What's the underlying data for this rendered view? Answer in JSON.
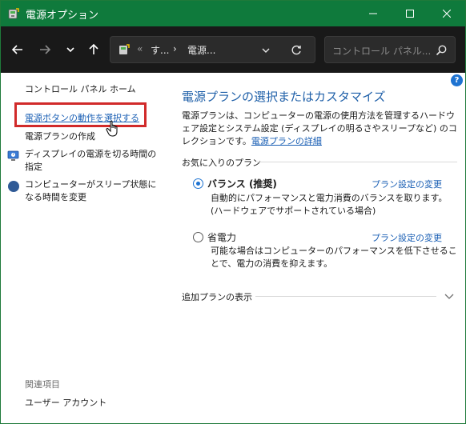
{
  "window": {
    "title": "電源オプション",
    "accent_color": "#0f7a3c"
  },
  "navbar": {
    "breadcrumb": {
      "overflow": "«",
      "item1": "す...",
      "separator": "›",
      "item2": "電源..."
    },
    "search_placeholder": "コントロール パネル..."
  },
  "sidebar": {
    "home": "コントロール パネル ホーム",
    "links": {
      "power_button": "電源ボタンの動作を選択する",
      "create_plan": "電源プランの作成",
      "display_off": "ディスプレイの電源を切る時間の指定",
      "sleep": "コンピューターがスリープ状態になる時間を変更"
    },
    "related_heading": "関連項目",
    "user_accounts": "ユーザー アカウント",
    "highlight_color": "#d12a2a"
  },
  "main": {
    "title": "電源プランの選択またはカスタマイズ",
    "description": "電源プランは、コンピューターの電源の使用方法を管理するハードウェア設定とシステム設定 (ディスプレイの明るさやスリープなど) のコレクションです。",
    "description_link": "電源プランの詳細",
    "favorites_label": "お気に入りのプラン",
    "plans": [
      {
        "name": "バランス (推奨)",
        "selected": true,
        "change_link": "プラン設定の変更",
        "description": "自動的にパフォーマンスと電力消費のバランスを取ります。(ハードウェアでサポートされている場合)"
      },
      {
        "name": "省電力",
        "selected": false,
        "change_link": "プラン設定の変更",
        "description": "可能な場合はコンピューターのパフォーマンスを低下させることで、電力の消費を抑えます。"
      }
    ],
    "additional_plans_label": "追加プランの表示",
    "help_glyph": "?"
  }
}
